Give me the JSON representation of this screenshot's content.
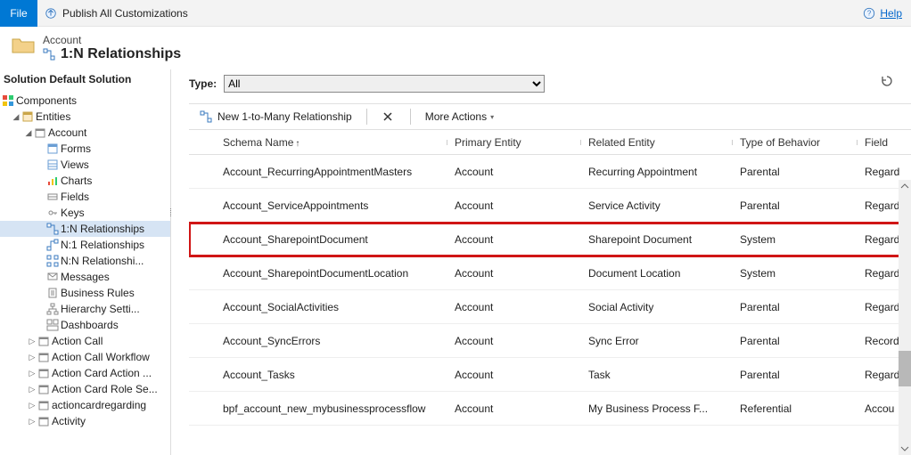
{
  "topbar": {
    "file": "File",
    "publish": "Publish All Customizations",
    "help": "Help"
  },
  "header": {
    "entity": "Account",
    "title": "1:N Relationships"
  },
  "solution_label": "Solution Default Solution",
  "tree": {
    "components": "Components",
    "entities": "Entities",
    "account": "Account",
    "children": [
      "Forms",
      "Views",
      "Charts",
      "Fields",
      "Keys",
      "1:N Relationships",
      "N:1 Relationships",
      "N:N Relationshi...",
      "Messages",
      "Business Rules",
      "Hierarchy Setti...",
      "Dashboards"
    ],
    "siblings": [
      "Action Call",
      "Action Call Workflow",
      "Action Card Action ...",
      "Action Card Role Se...",
      "actioncardregarding",
      "Activity"
    ]
  },
  "type_filter": {
    "label": "Type:",
    "value": "All"
  },
  "toolbar": {
    "new_rel": "New 1-to-Many Relationship",
    "more": "More Actions"
  },
  "columns": {
    "schema": "Schema Name",
    "primary": "Primary Entity",
    "related": "Related Entity",
    "behavior": "Type of Behavior",
    "field": "Field"
  },
  "rows": [
    {
      "schema": "Account_RecurringAppointmentMasters",
      "primary": "Account",
      "related": "Recurring Appointment",
      "behavior": "Parental",
      "field": "Regard",
      "highlight": false
    },
    {
      "schema": "Account_ServiceAppointments",
      "primary": "Account",
      "related": "Service Activity",
      "behavior": "Parental",
      "field": "Regard",
      "highlight": false
    },
    {
      "schema": "Account_SharepointDocument",
      "primary": "Account",
      "related": "Sharepoint Document",
      "behavior": "System",
      "field": "Regard",
      "highlight": true
    },
    {
      "schema": "Account_SharepointDocumentLocation",
      "primary": "Account",
      "related": "Document Location",
      "behavior": "System",
      "field": "Regard",
      "highlight": false
    },
    {
      "schema": "Account_SocialActivities",
      "primary": "Account",
      "related": "Social Activity",
      "behavior": "Parental",
      "field": "Regard",
      "highlight": false
    },
    {
      "schema": "Account_SyncErrors",
      "primary": "Account",
      "related": "Sync Error",
      "behavior": "Parental",
      "field": "Record",
      "highlight": false
    },
    {
      "schema": "Account_Tasks",
      "primary": "Account",
      "related": "Task",
      "behavior": "Parental",
      "field": "Regard",
      "highlight": false
    },
    {
      "schema": "bpf_account_new_mybusinessprocessflow",
      "primary": "Account",
      "related": "My Business Process F...",
      "behavior": "Referential",
      "field": "Accou",
      "highlight": false
    }
  ]
}
